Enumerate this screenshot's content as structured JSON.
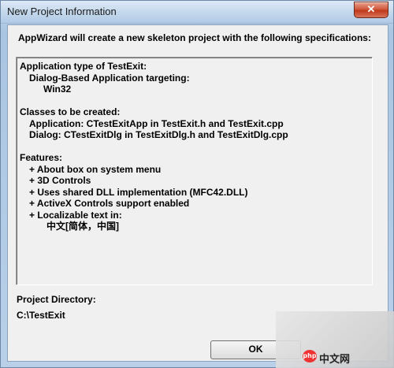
{
  "window": {
    "title": "New Project Information",
    "close_glyph": "✕"
  },
  "intro": "AppWizard will create a new skeleton project with the following specifications:",
  "spec": {
    "app_type_header": "Application type of TestExit:",
    "app_type_desc": "Dialog-Based Application targeting:",
    "platform": "Win32",
    "classes_header": "Classes to be created:",
    "class_application": "Application: CTestExitApp in TestExit.h and TestExit.cpp",
    "class_dialog": "Dialog: CTestExitDlg in TestExitDlg.h and TestExitDlg.cpp",
    "features_header": "Features:",
    "features": [
      "+ About box on system menu",
      "+ 3D Controls",
      "+ Uses shared DLL implementation (MFC42.DLL)",
      "+ ActiveX Controls support enabled",
      "+ Localizable text in:"
    ],
    "language": "中文[简体，中国]"
  },
  "project_directory_label": "Project Directory:",
  "project_directory_value": "C:\\TestExit",
  "ok_label": "OK",
  "watermark": {
    "logo_text": "php",
    "site_text": "中文网"
  }
}
